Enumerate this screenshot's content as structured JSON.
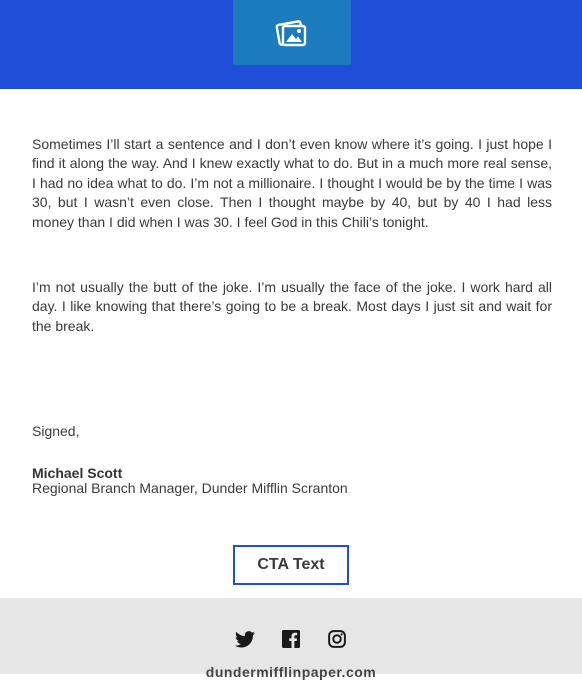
{
  "header": {
    "logo_icon": "image-placeholder-icon",
    "brand_color": "#1f4fd8",
    "logo_bg_color": "#1b7bbd"
  },
  "body": {
    "paragraph_1": "Sometimes I’ll start a sentence and I don’t even know where it’s going. I just hope I find it along the way. And I knew exactly what to do. But in a much more real sense, I had no idea what to do. I’m not a millionaire. I thought I would be by the time I was 30, but I wasn’t even close. Then I thought maybe by 40, but by 40 I had less money than I did when I was 30. I feel God in this Chili’s tonight.",
    "paragraph_2": "I’m not usually the butt of the joke. I’m usually the face of the joke. I work hard all day. I like knowing that there’s going to be a break. Most days I just sit and wait for the break.",
    "signed": "Signed,",
    "signature_name": "Michael Scott",
    "signature_title": "Regional Branch Manager, Dunder Mifflin Scranton"
  },
  "cta": {
    "label": "CTA Text"
  },
  "footer": {
    "social_icons": [
      "twitter-icon",
      "facebook-icon",
      "instagram-icon"
    ],
    "domain": "dundermifflinpaper.com"
  }
}
